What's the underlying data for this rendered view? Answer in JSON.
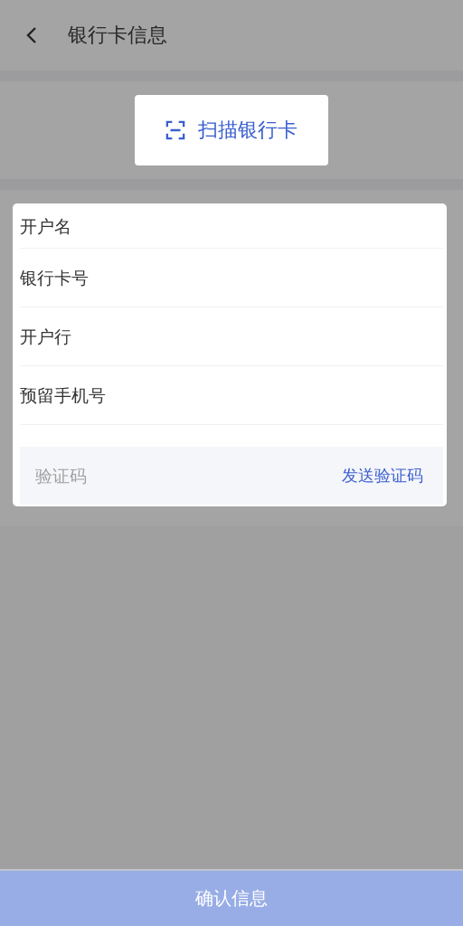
{
  "header": {
    "title": "银行卡信息"
  },
  "scan_button": {
    "label": "扫描银行卡"
  },
  "form": {
    "fields": [
      {
        "placeholder": "开户名"
      },
      {
        "placeholder": "银行卡号"
      },
      {
        "placeholder": "开户行"
      },
      {
        "placeholder": "预留手机号"
      }
    ],
    "code": {
      "placeholder": "验证码",
      "send_label": "发送验证码"
    }
  },
  "confirm_button": {
    "label": "确认信息",
    "disabled": true
  }
}
